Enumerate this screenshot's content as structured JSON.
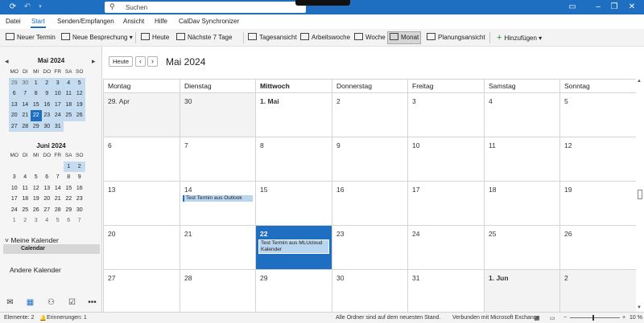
{
  "titlebar": {
    "search_placeholder": "Suchen",
    "icons": [
      "sync-icon",
      "undo-icon",
      "minimize-icon",
      "restore-icon",
      "close-icon"
    ]
  },
  "menu": {
    "items": [
      "Datei",
      "Start",
      "Senden/Empfangen",
      "Ansicht",
      "Hilfe",
      "CalDav Synchronizer"
    ],
    "active": "Start"
  },
  "ribbon": {
    "new_appointment": "Neuer Termin",
    "new_meeting": "Neue Besprechung",
    "today": "Heute",
    "next7": "Nächste 7 Tage",
    "day_view": "Tagesansicht",
    "work_week": "Arbeitswoche",
    "week": "Woche",
    "month": "Monat",
    "schedule_view": "Planungsansicht",
    "add": "Hinzufügen"
  },
  "mini_may": {
    "title": "Mai 2024",
    "headers": [
      "MO",
      "DI",
      "MI",
      "DO",
      "FR",
      "SA",
      "SO"
    ],
    "rows": [
      [
        "29",
        "30",
        "1",
        "2",
        "3",
        "4",
        "5"
      ],
      [
        "6",
        "7",
        "8",
        "9",
        "10",
        "11",
        "12"
      ],
      [
        "13",
        "14",
        "15",
        "16",
        "17",
        "18",
        "19"
      ],
      [
        "20",
        "21",
        "22",
        "23",
        "24",
        "25",
        "26"
      ],
      [
        "27",
        "28",
        "29",
        "30",
        "31",
        "",
        ""
      ]
    ]
  },
  "mini_june": {
    "title": "Juni 2024",
    "headers": [
      "MO",
      "DI",
      "MI",
      "DO",
      "FR",
      "SA",
      "SO"
    ],
    "rows": [
      [
        "",
        "",
        "",
        "",
        "",
        "1",
        "2"
      ],
      [
        "3",
        "4",
        "5",
        "6",
        "7",
        "8",
        "9"
      ],
      [
        "10",
        "11",
        "12",
        "13",
        "14",
        "15",
        "16"
      ],
      [
        "17",
        "18",
        "19",
        "20",
        "21",
        "22",
        "23"
      ],
      [
        "24",
        "25",
        "26",
        "27",
        "28",
        "29",
        "30"
      ],
      [
        "1",
        "2",
        "3",
        "4",
        "5",
        "6",
        "7"
      ]
    ]
  },
  "calendars": {
    "my_calendars": "Meine Kalender",
    "calendar_item": "Calendar",
    "other_calendars": "Andere Kalender"
  },
  "main": {
    "today_button": "Heute",
    "month_title": "Mai 2024",
    "weekdays": [
      "Montag",
      "Dienstag",
      "Mittwoch",
      "Donnerstag",
      "Freitag",
      "Samstag",
      "Sonntag"
    ],
    "weeks": [
      [
        "29. Apr",
        "30",
        "1. Mai",
        "2",
        "3",
        "4",
        "5"
      ],
      [
        "6",
        "7",
        "8",
        "9",
        "10",
        "11",
        "12"
      ],
      [
        "13",
        "14",
        "15",
        "16",
        "17",
        "18",
        "19"
      ],
      [
        "20",
        "21",
        "22",
        "23",
        "24",
        "25",
        "26"
      ],
      [
        "27",
        "28",
        "29",
        "30",
        "31",
        "1. Jun",
        "2"
      ]
    ],
    "events": {
      "may14": "Test Termin aus Outlook",
      "may22": "Test Termin aus MLUcloud Kalender"
    }
  },
  "status": {
    "items": "Elemente: 2",
    "reminders": "Erinnerungen: 1",
    "all_folders": "Alle Ordner sind auf dem neuesten Stand.",
    "connected": "Verbunden mit Microsoft Exchange",
    "zoom": "10 %"
  },
  "colors": {
    "accent": "#1e6fc2",
    "event_fill": "#b9d6f1"
  }
}
